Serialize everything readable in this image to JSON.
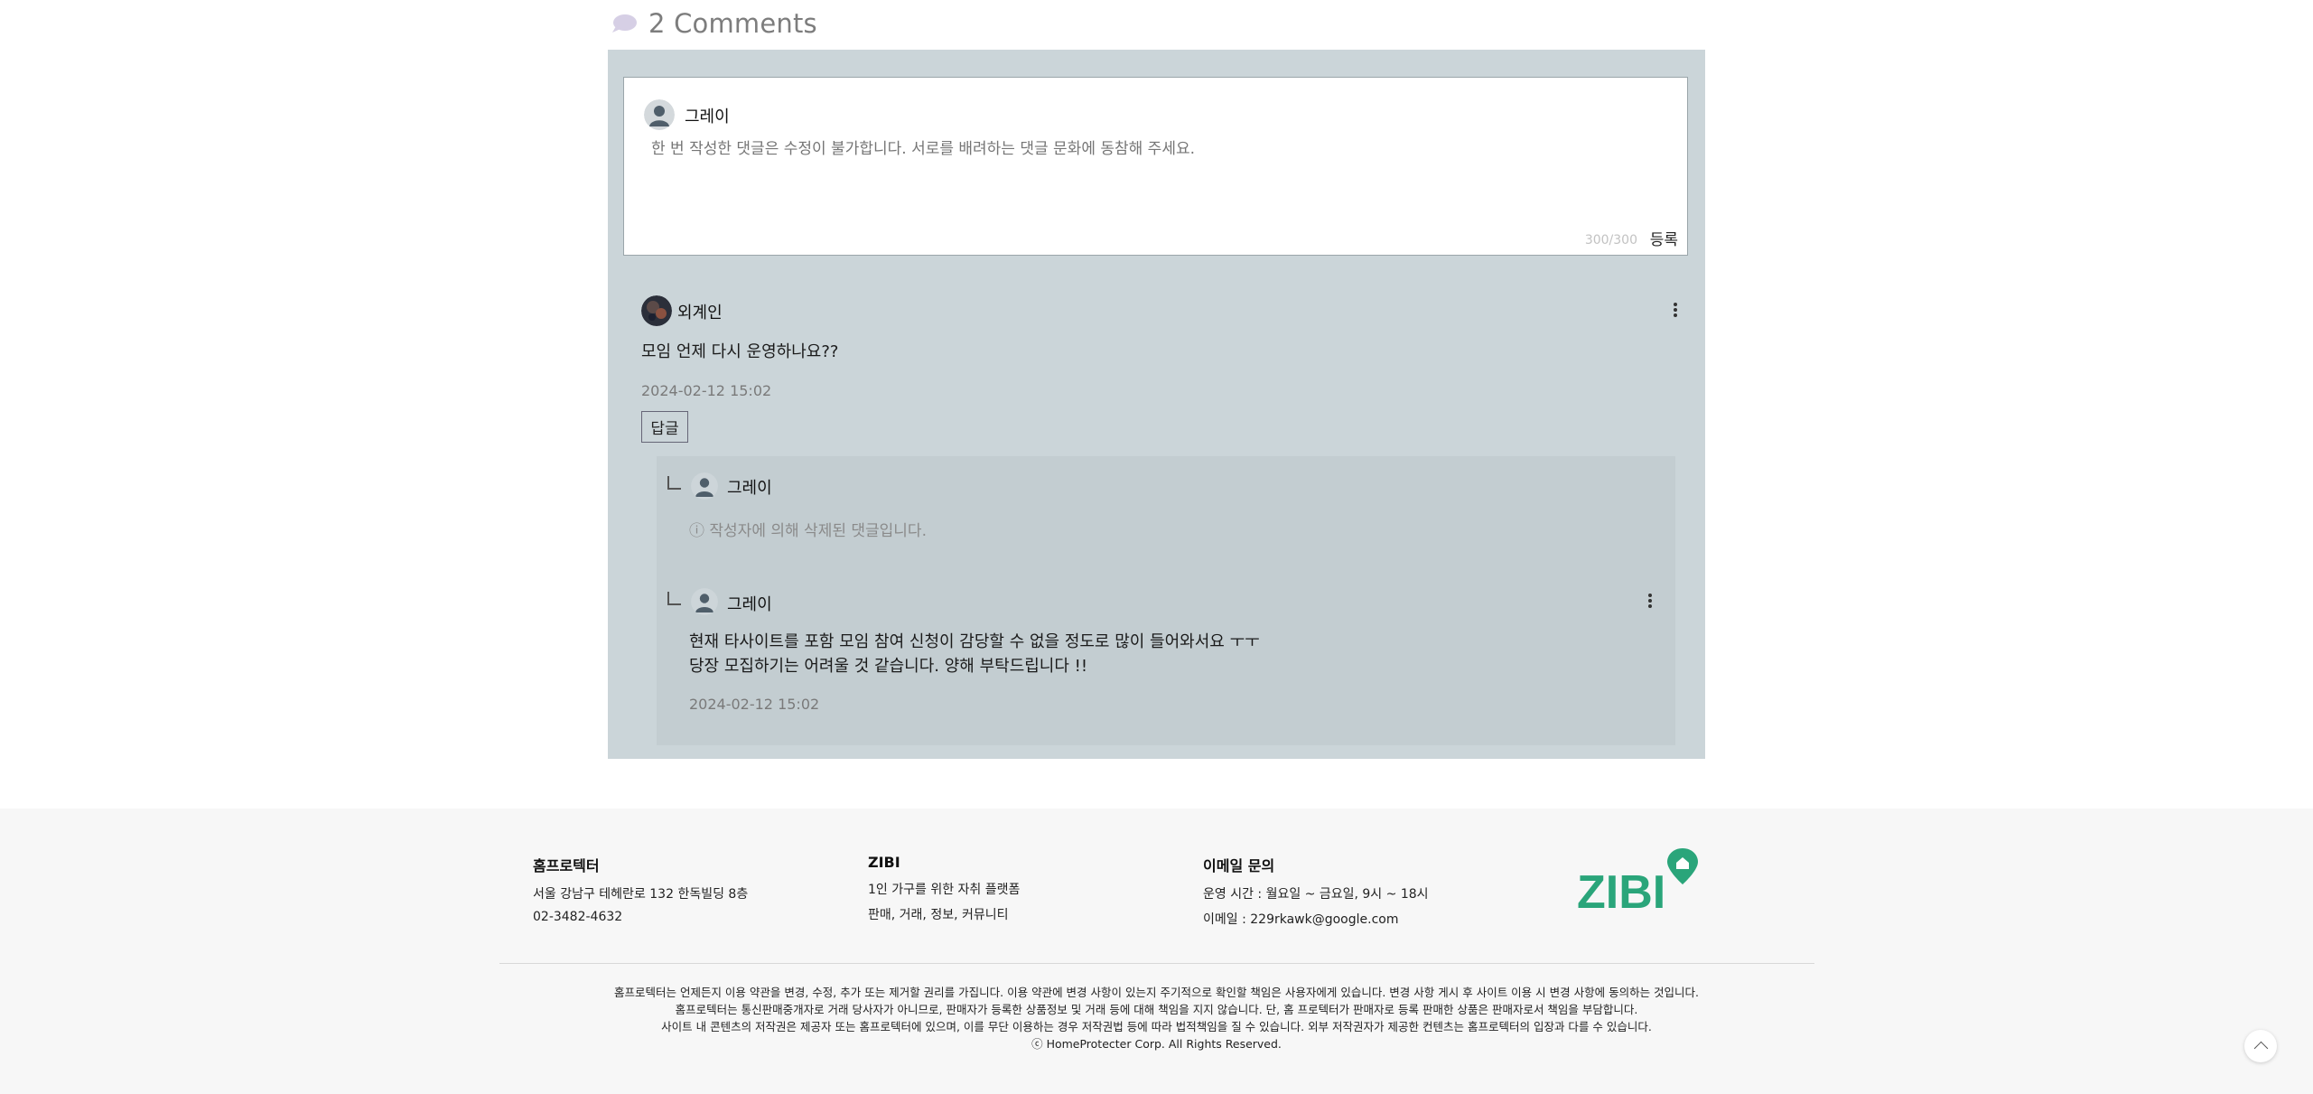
{
  "comments": {
    "title": "2 Comments",
    "icon": "speech-bubble-icon",
    "accent_color": "#d6cfe5"
  },
  "write_box": {
    "author": "그레이",
    "placeholder": "한 번 작성한 댓글은 수정이 불가합니다. 서로를 배려하는 댓글 문화에 동참해 주세요.",
    "char_count": "300/300",
    "submit_label": "등록"
  },
  "comment": {
    "author": "외계인",
    "body": "모임 언제 다시 운영하나요??",
    "date": "2024-02-12 15:02",
    "reply_label": "답글",
    "replies": [
      {
        "author": "그레이",
        "deleted_text": "ⓘ 작성자에 의해 삭제된 댓글입니다."
      },
      {
        "author": "그레이",
        "body_line1": "현재 타사이트를 포함 모임 참여 신청이 감당할 수 없을 정도로 많이 들어와서요 ㅜㅜ",
        "body_line2": "당장 모집하기는 어려울 것 같습니다. 양해 부탁드립니다 !!",
        "date": "2024-02-12 15:02"
      }
    ]
  },
  "footer": {
    "col1": {
      "title": "홈프로텍터",
      "line1": "서울 강남구 테헤란로 132 한독빌딩 8층",
      "line2": "02-3482-4632"
    },
    "col2": {
      "title": "ZIBI",
      "line1": "1인 가구를 위한 자취 플랫폼",
      "line2": "판매, 거래, 정보, 커뮤니티"
    },
    "col3": {
      "title": "이메일 문의",
      "line1": "운영 시간 : 월요일 ~ 금요일, 9시 ~ 18시",
      "line2": "이메일 : 229rkawk@google.com"
    },
    "logo_text": "ZIBI",
    "brand_color": "#2aa57a",
    "legal": [
      "홈프로텍터는 언제든지 이용 약관을 변경, 수정, 추가 또는 제거할 권리를 가집니다. 이용 약관에 변경 사항이 있는지 주기적으로 확인할 책임은 사용자에게 있습니다. 변경 사항 게시 후 사이트 이용 시 변경 사항에 동의하는 것입니다.",
      "홈프로텍터는 통신판매중개자로 거래 당사자가 아니므로, 판매자가 등록한 상품정보 및 거래 등에 대해 책임을 지지 않습니다. 단, 홈 프로텍터가 판매자로 등록 판매한 상품은 판매자로서 책임을 부담합니다.",
      "사이트 내 콘텐츠의 저작권은 제공자 또는 홈프로텍터에 있으며, 이를 무단 이용하는 경우 저작권법 등에 따라 법적책임을 질 수 있습니다. 외부 저작권자가 제공한 컨텐츠는 홈프로텍터의 입장과 다를 수 있습니다.",
      "ⓒ HomeProtecter Corp. All Rights Reserved."
    ]
  }
}
